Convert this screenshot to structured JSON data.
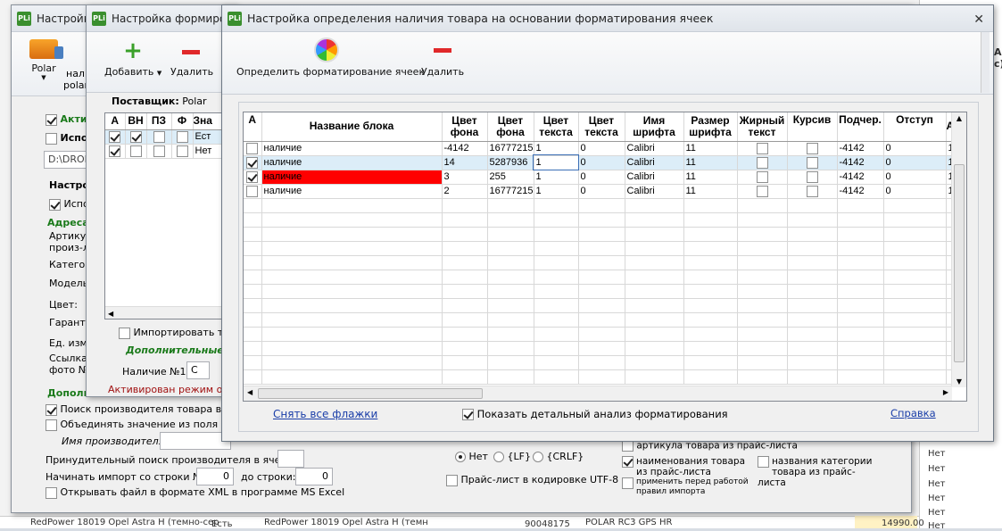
{
  "win1": {
    "title": "Настройка"
  },
  "win1_toolbar": {
    "polar": "Polar",
    "nal": "нал",
    "polar2": "polar"
  },
  "win1_form": {
    "active_label": "Активи",
    "use_label": "Испол",
    "path_value": "D:\\DROP",
    "settings_header": "Настро",
    "use2_label": "Испо",
    "address_header": "Адреса",
    "article_label": "Артикул",
    "article_label2": "произ-л",
    "category_label": "Катего",
    "model_label": "Модель",
    "color_label": "Цвет:",
    "warranty_label": "Гаранти",
    "unit_label": "Ед. изм",
    "photo_link_label": "Ссылка",
    "photo_label": "фото №",
    "additional_header": "Дополн",
    "search_manufacturer": "Поиск производителя товара в наименовании",
    "combine_value": "Объединять значение из поля \"Имя",
    "manufacturer_name_label": "Имя производителя:",
    "forced_search_label": "Принудительный поиск производителя в ячейке:",
    "start_row_label": "Начинать импорт со строки №:",
    "start_row_value": "0",
    "to_row_label": "до строки:",
    "to_row_value": "0",
    "open_xml_label": "Открывать файл в формате XML в программе MS Excel",
    "newline_none": "Нет",
    "newline_lf": "{LF}",
    "newline_crlf": "{CRLF}",
    "utf8_label": "Прайс-лист в кодировке UTF-8",
    "article_from_price": "артикула товара из прайс-листа",
    "name_from_price": "наименования товара из прайс-листа",
    "category_names": "названия  категории товара из прайс-листа",
    "apply_before": "применить перед работой правил импорта"
  },
  "bg_rows": [
    {
      "col1": "RedPower 18019 Opel Astra H (темно-сер",
      "col2": "Есть",
      "col3": "RedPower 18019 Opel Astra H (темн",
      "col4": "90048175",
      "col5": "POLAR RC3 GPS HR",
      "col6": "14990.00"
    }
  ],
  "bg_right": {
    "net_values": [
      "Нет",
      "Нет",
      "Нет",
      "Нет",
      "Нет",
      "Нет"
    ],
    "top_header": "Ар",
    "top_header2": "с)"
  },
  "win2": {
    "title": "Настройка формиро",
    "add_label": "Добавить",
    "delete_label": "Удалить",
    "supplier_label": "Поставщик:",
    "supplier_value": "Polar",
    "columns": [
      "А",
      "ВН",
      "ПЗ",
      "Ф",
      "Зна"
    ],
    "rows": [
      {
        "a": true,
        "vn": true,
        "pz": false,
        "f": false,
        "val": "Ест"
      },
      {
        "a": true,
        "vn": false,
        "pz": false,
        "f": false,
        "val": "Нет"
      }
    ],
    "import_only_label": "Импортировать тол",
    "additional_label": "Дополнительные",
    "availability_label": "Наличие №1:",
    "availability_value": "С",
    "status_text": "Активирован режим опр"
  },
  "win3": {
    "title": "Настройка определения наличия товара на основании форматирования ячеек",
    "detect_label": "Определить форматирование ячеек",
    "delete_label": "Удалить",
    "columns": [
      "А",
      "Название блока",
      "Цвет фона",
      "Цвет фона",
      "Цвет текста",
      "Цвет текста",
      "Имя шрифта",
      "Размер шрифта",
      "Жирный текст",
      "Курсив",
      "Подчер.",
      "Отступ",
      "А с"
    ],
    "rows": [
      {
        "checked": false,
        "name": "наличие",
        "bg1": "-4142",
        "bg2": "16777215",
        "tx1": "1",
        "tx2": "0",
        "font": "Calibri",
        "size": "11",
        "bold": false,
        "italic": false,
        "under": "-4142",
        "indent": "0",
        "last": "1",
        "selected": false,
        "red": false
      },
      {
        "checked": true,
        "name": "наличие",
        "bg1": "14",
        "bg2": "5287936",
        "tx1": "1",
        "tx2": "0",
        "font": "Calibri",
        "size": "11",
        "bold": false,
        "italic": false,
        "under": "-4142",
        "indent": "0",
        "last": "1",
        "selected": true,
        "red": false
      },
      {
        "checked": true,
        "name": "наличие",
        "bg1": "3",
        "bg2": "255",
        "tx1": "1",
        "tx2": "0",
        "font": "Calibri",
        "size": "11",
        "bold": false,
        "italic": false,
        "under": "-4142",
        "indent": "0",
        "last": "1",
        "selected": false,
        "red": true
      },
      {
        "checked": false,
        "name": "наличие",
        "bg1": "2",
        "bg2": "16777215",
        "tx1": "1",
        "tx2": "0",
        "font": "Calibri",
        "size": "11",
        "bold": false,
        "italic": false,
        "under": "-4142",
        "indent": "0",
        "last": "1",
        "selected": false,
        "red": false
      }
    ],
    "clear_flags": "Снять все флажки",
    "show_analysis": "Показать детальный анализ форматирования",
    "help": "Справка"
  },
  "colors": {
    "red_cell": "#ff0000",
    "selected_row": "#dcedf8",
    "link": "#1a3ea8",
    "green_header": "#1a7a1a"
  }
}
